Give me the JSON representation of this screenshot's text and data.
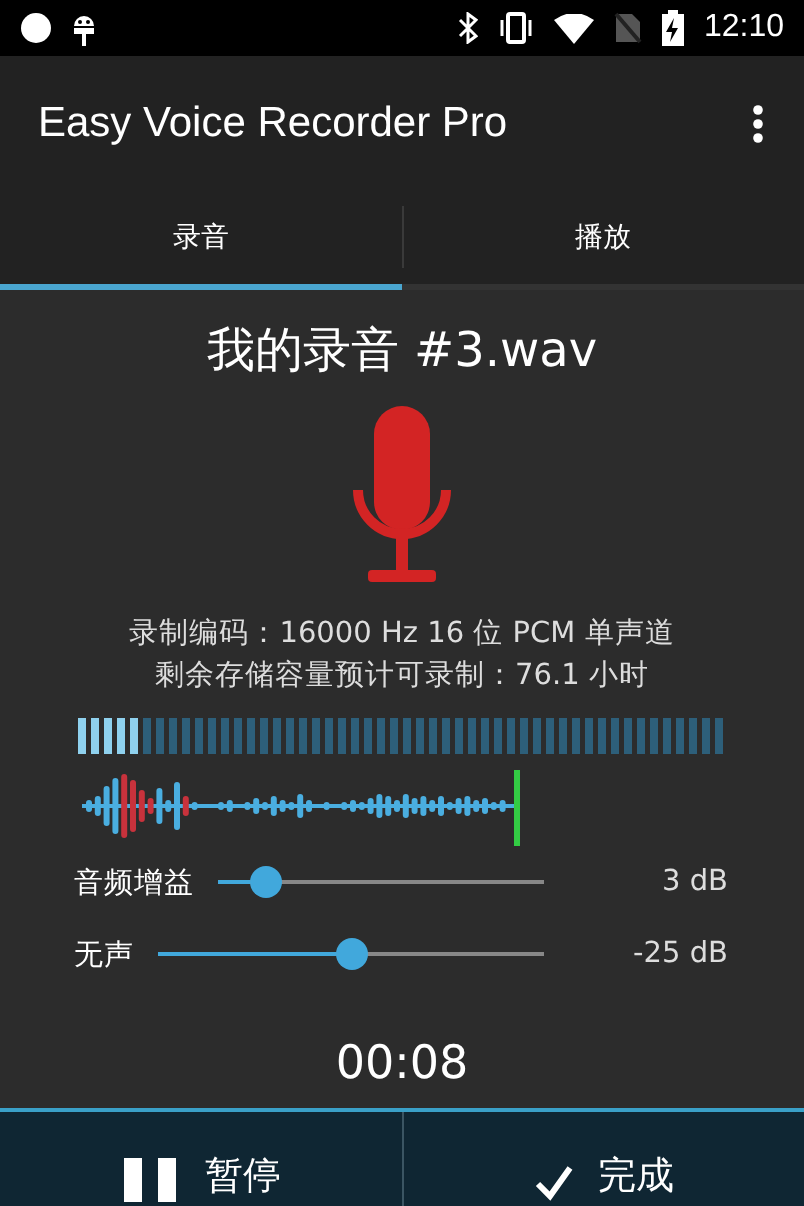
{
  "status_bar": {
    "time": "12:10"
  },
  "app_bar": {
    "title": "Easy Voice Recorder Pro"
  },
  "tabs": [
    {
      "label": "录音",
      "selected": true
    },
    {
      "label": "播放",
      "selected": false
    }
  ],
  "recording": {
    "file_name": "我的录音 #3.wav",
    "encoding": "录制编码：16000 Hz 16 位 PCM 单声道",
    "remaining": "剩余存储容量预计可录制：76.1 小时",
    "input_level": {
      "level": 0.1
    }
  },
  "sliders": [
    {
      "label": "音频增益",
      "level": 0.15,
      "reading": "3 dB"
    },
    {
      "label": "无声",
      "level": 0.5,
      "reading": "-25 dB"
    }
  ],
  "timer": "00:08",
  "actions": [
    {
      "kind": "pause",
      "label": "暂停"
    },
    {
      "kind": "done",
      "label": "完成"
    }
  ]
}
